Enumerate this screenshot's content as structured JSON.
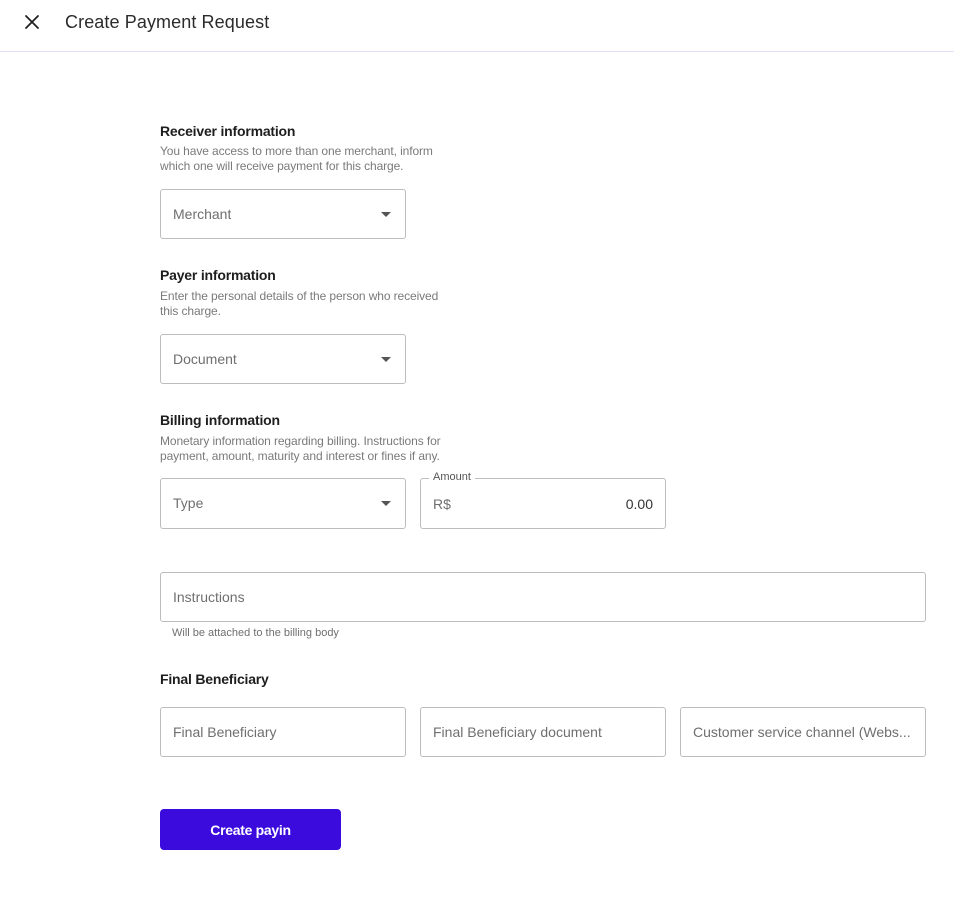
{
  "header": {
    "title": "Create Payment Request"
  },
  "receiver": {
    "title": "Receiver information",
    "desc_line1": "You have access to more than one merchant, inform",
    "desc_line2": "which one will receive payment for this charge.",
    "merchant_placeholder": "Merchant"
  },
  "payer": {
    "title": "Payer information",
    "desc_line1": "Enter the personal details of the person who received",
    "desc_line2": "this charge.",
    "document_placeholder": "Document"
  },
  "billing": {
    "title": "Billing information",
    "desc_line1": "Monetary information regarding billing. Instructions for",
    "desc_line2": "payment, amount, maturity and interest or fines if any.",
    "type_placeholder": "Type",
    "amount_label": "Amount",
    "amount_prefix": "R$",
    "amount_value": "0.00",
    "instructions_placeholder": "Instructions",
    "instructions_helper": "Will be attached to the billing body"
  },
  "beneficiary": {
    "title": "Final Beneficiary",
    "name_placeholder": "Final Beneficiary",
    "document_placeholder": "Final Beneficiary document",
    "channel_placeholder": "Customer service channel (Webs..."
  },
  "actions": {
    "create_label": "Create payin"
  },
  "colors": {
    "accent": "#3a0bdc",
    "border": "#bdbdbd",
    "header_border": "#e2e0f7"
  }
}
